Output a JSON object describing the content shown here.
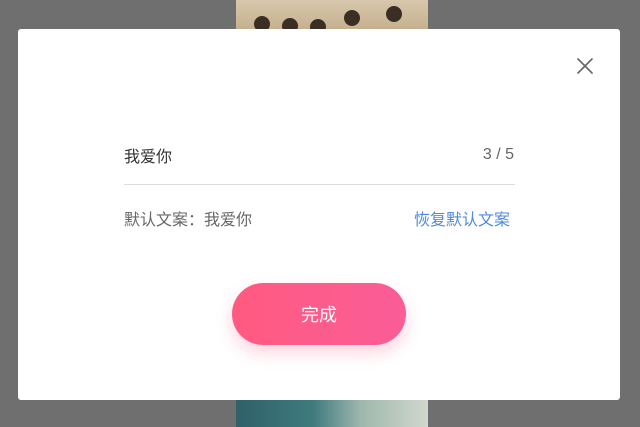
{
  "dialog": {
    "input_value": "我爱你",
    "char_count": "3 / 5",
    "default_text_label": "默认文案：",
    "default_text_value": "我爱你",
    "restore_link": "恢复默认文案",
    "done_button": "完成"
  },
  "colors": {
    "accent_pink": "#ff5a80",
    "link_blue": "#4e8ae0",
    "overlay": "#6f6f6f"
  },
  "icons": {
    "close": "close-icon"
  }
}
